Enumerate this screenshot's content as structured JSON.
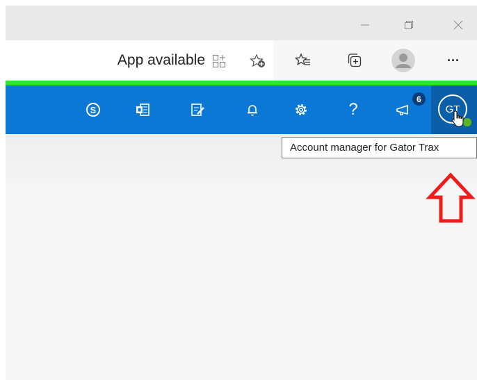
{
  "browser": {
    "window_controls": [
      "minimize",
      "restore",
      "close"
    ],
    "toolbar": {
      "app_available_label": "App available",
      "icons": [
        "app-available-icon",
        "add-favorite-icon",
        "favorites-icon",
        "collections-icon",
        "profile-icon",
        "more-icon"
      ],
      "more_label": "···"
    },
    "accent_line_color": "#2ce52c"
  },
  "app_bar": {
    "background_color": "#0a78d4",
    "icons": [
      "skype-icon",
      "office-icon",
      "tasks-icon",
      "bell-icon",
      "gear-icon",
      "help-icon",
      "megaphone-icon"
    ],
    "help_label": "?",
    "whats_new_badge": "6",
    "account": {
      "initials": "GT",
      "status": "available",
      "status_color": "#5bb71e"
    }
  },
  "tooltip": {
    "text": "Account manager for Gator Trax"
  }
}
